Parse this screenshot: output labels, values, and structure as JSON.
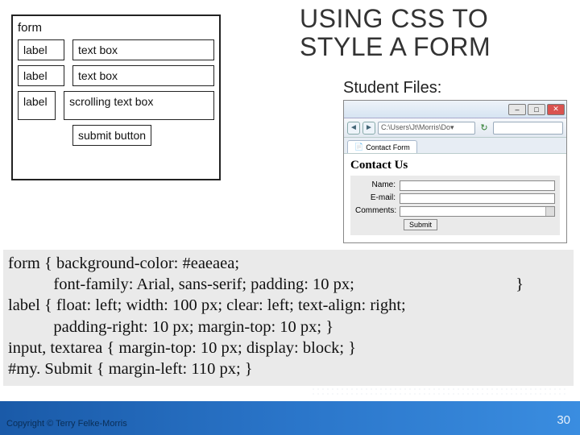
{
  "title_line1": "USING CSS TO",
  "title_line2": "STYLE A FORM",
  "student_files_label": "Student Files:",
  "wireframe": {
    "caption": "form",
    "label1": "label",
    "box1": "text box",
    "label2": "label",
    "box2": "text box",
    "label3": "label",
    "box3": "scrolling text box",
    "submit": "submit button"
  },
  "browser": {
    "wnd_min": "–",
    "wnd_max": "□",
    "wnd_close": "✕",
    "nav_back": "◄",
    "nav_fwd": "►",
    "address": "C:\\Users\\Jt\\Morris\\Do▾",
    "refresh": "↻",
    "tab_icon": "📄",
    "tab_title": "Contact Form",
    "page_heading": "Contact Us",
    "form_name": "Name:",
    "form_email": "E-mail:",
    "form_comments": "Comments:",
    "form_submit": "Submit"
  },
  "code": {
    "l1a": "form { background-color: #eaeaea;",
    "l2a": "           font-family: Arial, sans-serif; padding: 10 px;",
    "l2b": "}",
    "l3": "label { float: left; width: 100 px; clear: left; text-align: right;",
    "l4": "           padding-right: 10 px; margin-top: 10 px; }",
    "l5": "input, textarea { margin-top: 10 px; display: block; }",
    "l6": "#my. Submit { margin-left: 110 px; }"
  },
  "footer": {
    "copyright": "Copyright © Terry Felke-Morris",
    "page": "30"
  }
}
